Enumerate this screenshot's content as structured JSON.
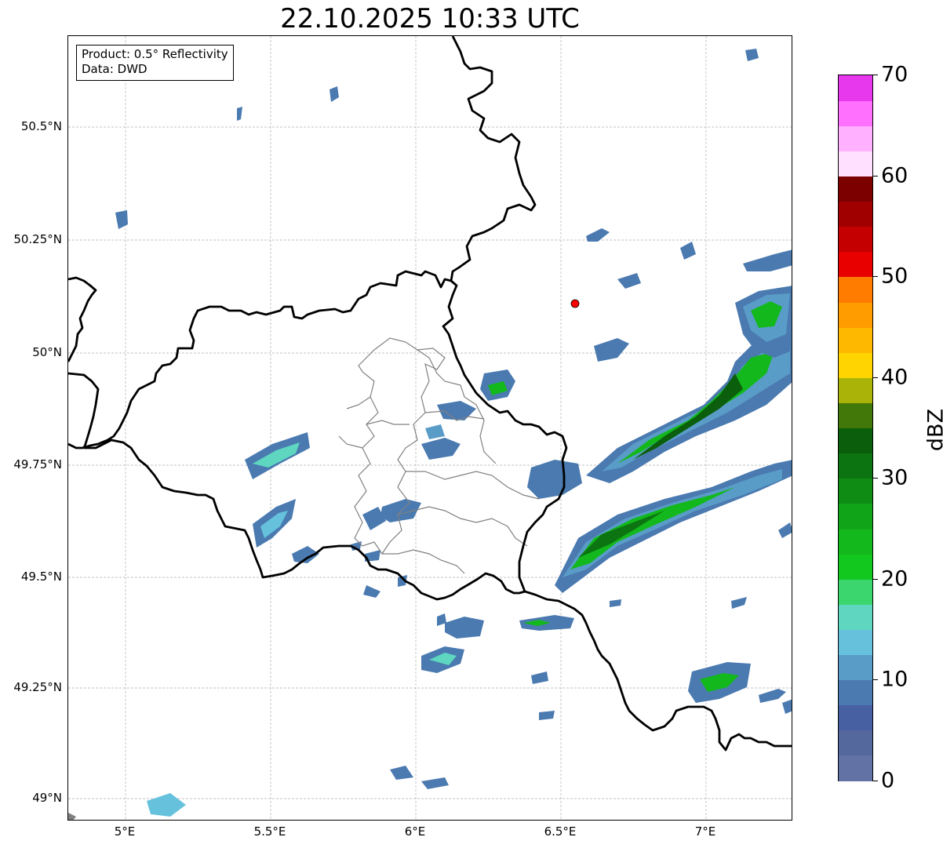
{
  "title": "22.10.2025 10:33 UTC",
  "info": {
    "product": "Product: 0.5° Reflectivity",
    "data": "Data: DWD"
  },
  "lat_ticks": [
    "50.5°N",
    "50.25°N",
    "50°N",
    "49.75°N",
    "49.5°N",
    "49.25°N",
    "49°N"
  ],
  "lon_ticks": [
    "5°E",
    "5.5°E",
    "6°E",
    "6.5°E",
    "7°E"
  ],
  "colorbar": {
    "unit": "dBZ",
    "tick_labels": [
      "0",
      "10",
      "20",
      "30",
      "40",
      "50",
      "60",
      "70"
    ],
    "range": [
      0,
      70
    ],
    "colors": [
      "#6272a4",
      "#54689e",
      "#4660a2",
      "#4a7ab0",
      "#5a9cc8",
      "#66c2dc",
      "#5ed6c0",
      "#3cd66e",
      "#12c81e",
      "#12b81c",
      "#10a418",
      "#0e8c14",
      "#0c7410",
      "#0a5e0c",
      "#42780a",
      "#aab408",
      "#ffd400",
      "#ffb800",
      "#ff9c00",
      "#ff7c00",
      "#e80000",
      "#c40000",
      "#a00000",
      "#7c0000",
      "#ffe0ff",
      "#ffb0ff",
      "#ff70ff",
      "#e838ee"
    ]
  },
  "radar_site": {
    "lon": 6.547,
    "lat": 50.11,
    "color": "#ff0000"
  },
  "map_extent": {
    "lon": [
      4.8,
      7.3
    ],
    "lat": [
      48.95,
      50.7
    ]
  },
  "colors": {
    "border": "#000000",
    "admin": "#808080",
    "grid": "#b0b0b0"
  }
}
